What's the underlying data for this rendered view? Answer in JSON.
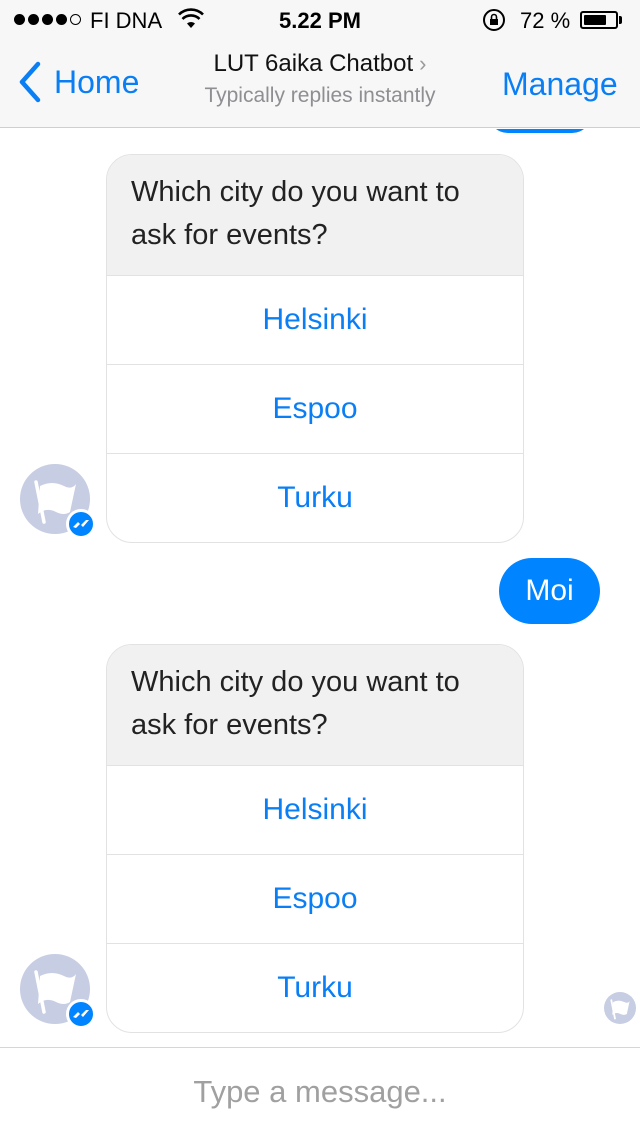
{
  "status_bar": {
    "carrier": "FI DNA",
    "time": "5.22 PM",
    "battery_percent": "72 %",
    "battery_level": 0.72,
    "signal_bars_filled": 4,
    "signal_bars_total": 5
  },
  "header": {
    "back_label": "Home",
    "title": "LUT 6aika Chatbot",
    "subtitle": "Typically replies instantly",
    "manage_label": "Manage"
  },
  "messages": [
    {
      "type": "quick_reply_card",
      "question": "Which city do you want to ask for events?",
      "options": [
        "Helsinki",
        "Espoo",
        "Turku"
      ]
    },
    {
      "type": "user_text",
      "text": "Moi"
    },
    {
      "type": "quick_reply_card",
      "question": "Which city do you want to ask for events?",
      "options": [
        "Helsinki",
        "Espoo",
        "Turku"
      ]
    }
  ],
  "composer": {
    "placeholder": "Type a message..."
  },
  "colors": {
    "accent": "#0a7ff5",
    "bubble": "#0084ff",
    "avatar_bg": "#c7cde2"
  }
}
